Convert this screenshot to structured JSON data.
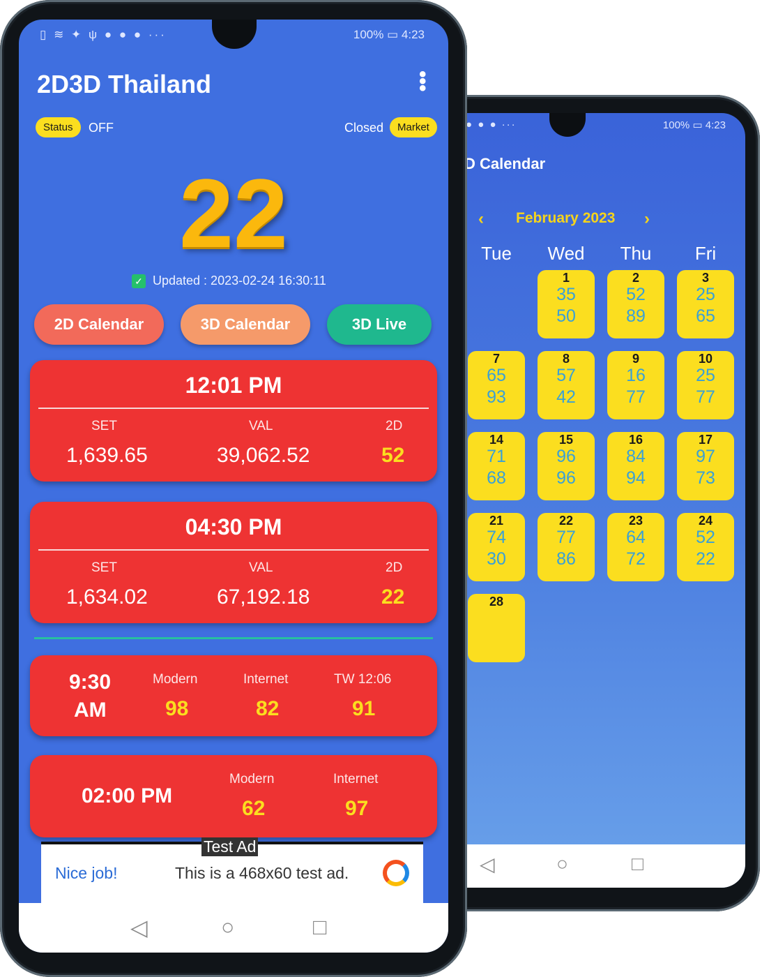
{
  "right_phone": {
    "status_bar": {
      "left_icons": "● ● ● ···",
      "battery": "100%",
      "time": "4:23"
    },
    "title": "D Calendar",
    "month_nav": {
      "prev": "‹",
      "month": "February 2023",
      "next": "›"
    },
    "weekdays": [
      "Tue",
      "Wed",
      "Thu",
      "Fri"
    ],
    "days": [
      {
        "day": "1",
        "top": "35",
        "bottom": "50"
      },
      {
        "day": "2",
        "top": "52",
        "bottom": "89"
      },
      {
        "day": "3",
        "top": "25",
        "bottom": "65"
      },
      {
        "day": "7",
        "top": "65",
        "bottom": "93"
      },
      {
        "day": "8",
        "top": "57",
        "bottom": "42"
      },
      {
        "day": "9",
        "top": "16",
        "bottom": "77"
      },
      {
        "day": "10",
        "top": "25",
        "bottom": "77"
      },
      {
        "day": "14",
        "top": "71",
        "bottom": "68"
      },
      {
        "day": "15",
        "top": "96",
        "bottom": "96"
      },
      {
        "day": "16",
        "top": "84",
        "bottom": "94"
      },
      {
        "day": "17",
        "top": "97",
        "bottom": "73"
      },
      {
        "day": "21",
        "top": "74",
        "bottom": "30"
      },
      {
        "day": "22",
        "top": "77",
        "bottom": "86"
      },
      {
        "day": "23",
        "top": "64",
        "bottom": "72"
      },
      {
        "day": "24",
        "top": "52",
        "bottom": "22"
      },
      {
        "day": "28",
        "top": "",
        "bottom": ""
      }
    ],
    "nav": {
      "back": "◁",
      "home": "○",
      "recent": "□"
    }
  },
  "left_phone": {
    "status_bar": {
      "left_icons": "▯ ≋ ✦ ψ ● ● ● ···",
      "battery": "100%",
      "time": "4:23"
    },
    "app_title": "2D3D Thailand",
    "menu_icon": "⋮",
    "status": {
      "label": "Status",
      "value": "OFF"
    },
    "market": {
      "value": "Closed",
      "label": "Market"
    },
    "current_number": "22",
    "updated": "Updated : 2023-02-24 16:30:11",
    "buttons": {
      "calendar_2d": "2D Calendar",
      "calendar_3d": "3D Calendar",
      "live_3d": "3D Live"
    },
    "sessions": [
      {
        "time": "12:01 PM",
        "set_label": "SET",
        "val_label": "VAL",
        "d_label": "2D",
        "set": "1,639.65",
        "val": "39,062.52",
        "d": "52"
      },
      {
        "time": "04:30 PM",
        "set_label": "SET",
        "val_label": "VAL",
        "d_label": "2D",
        "set": "1,634.02",
        "val": "67,192.18",
        "d": "22"
      }
    ],
    "morning": {
      "time_line1": "9:30",
      "time_line2": "AM",
      "modern_label": "Modern",
      "modern": "98",
      "internet_label": "Internet",
      "internet": "82",
      "tw_label": "TW 12:06",
      "tw": "91"
    },
    "afternoon": {
      "time": "02:00 PM",
      "modern_label": "Modern",
      "modern": "62",
      "internet_label": "Internet",
      "internet": "97"
    },
    "ad": {
      "badge": "Test Ad",
      "headline": "Nice job!",
      "body": "This is a 468x60 test ad."
    },
    "nav": {
      "back": "◁",
      "home": "○",
      "recent": "□"
    }
  }
}
